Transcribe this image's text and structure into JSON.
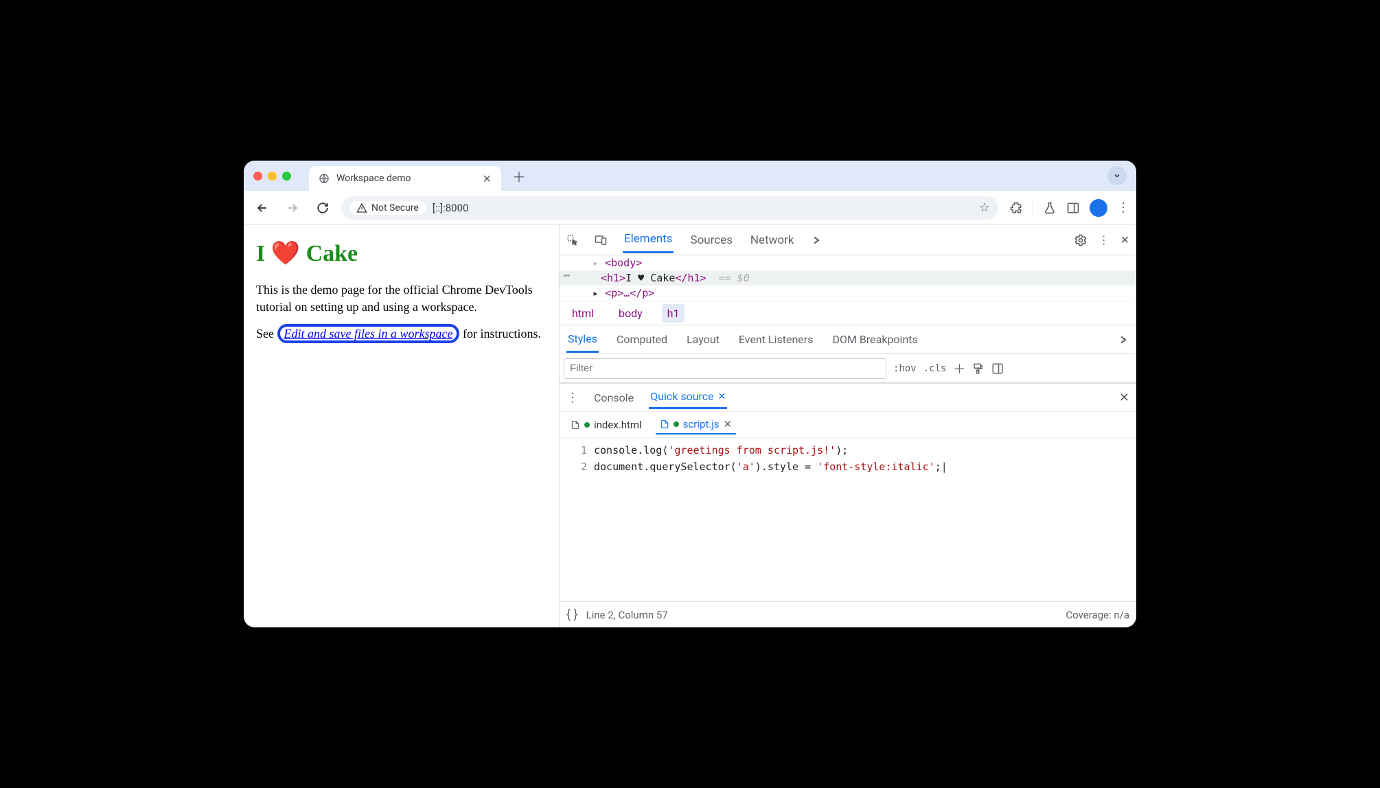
{
  "browser": {
    "tab_title": "Workspace demo",
    "security_label": "Not Secure",
    "url": "[::]:8000"
  },
  "page": {
    "heading": "I ❤️ Cake",
    "para1": "This is the demo page for the official Chrome DevTools tutorial on setting up and using a workspace.",
    "para2_pre": "See ",
    "link_text": "Edit and save files in a workspace",
    "para2_post": " for instructions."
  },
  "devtools": {
    "tabs": [
      "Elements",
      "Sources",
      "Network"
    ],
    "active_tab": "Elements",
    "dom": {
      "line_above": "<body>",
      "selected_open": "<h1>",
      "selected_text": "I ♥ Cake",
      "selected_close": "</h1>",
      "eq_hint": "== $0",
      "line_below": "<p>…</p>",
      "crumbs": [
        "html",
        "body",
        "h1"
      ]
    },
    "styles_tabs": [
      "Styles",
      "Computed",
      "Layout",
      "Event Listeners",
      "DOM Breakpoints"
    ],
    "styles_active": "Styles",
    "filter_placeholder": "Filter",
    "hov_label": ":hov",
    "cls_label": ".cls",
    "drawer": {
      "tabs": [
        "Console",
        "Quick source"
      ],
      "active": "Quick source",
      "files": [
        "index.html",
        "script.js"
      ],
      "active_file": "script.js",
      "code_lines": [
        "console.log('greetings from script.js!');",
        "document.querySelector('a').style = 'font-style:italic';"
      ],
      "status_pos": "Line 2, Column 57",
      "coverage": "Coverage: n/a"
    }
  }
}
